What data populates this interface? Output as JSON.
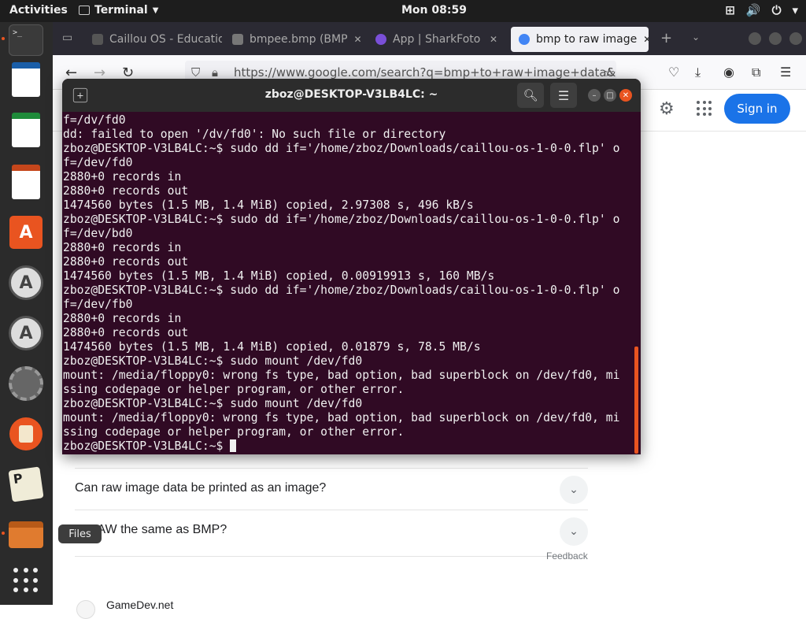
{
  "topbar": {
    "activities": "Activities",
    "app_name": "Terminal",
    "clock": "Mon 08:59",
    "tray_icons": [
      "network-icon",
      "volume-icon",
      "power-icon",
      "menu-caret-icon"
    ]
  },
  "dock": {
    "items": [
      "terminal",
      "libreoffice-writer",
      "libreoffice-calc",
      "libreoffice-impress",
      "software-store",
      "software-updater",
      "software-updater-2",
      "settings",
      "app-round",
      "pos-app",
      "files",
      "show-applications"
    ],
    "tooltip": "Files"
  },
  "browser": {
    "tabs": [
      {
        "label": "Caillou OS - Educatio",
        "favicon_color": "#555555"
      },
      {
        "label": "bmpee.bmp (BMP",
        "favicon_color": "#777777"
      },
      {
        "label": "App | SharkFoto",
        "favicon_color": "#7a4fd8"
      },
      {
        "label": "bmp to raw image",
        "favicon_color": "#4285f4"
      }
    ],
    "url": "https://www.google.com/search?q=bmp+to+raw+image+data&cl",
    "google": {
      "signin": "Sign in",
      "faq": [
        "Can raw image data be printed as an image?",
        "Is RAW the same as BMP?"
      ],
      "feedback": "Feedback",
      "result_source": "GameDev.net"
    }
  },
  "terminal": {
    "title": "zboz@DESKTOP-V3LB4LC: ~",
    "lines": [
      "f=/dv/fd0",
      "dd: failed to open '/dv/fd0': No such file or directory",
      "zboz@DESKTOP-V3LB4LC:~$ sudo dd if='/home/zboz/Downloads/caillou-os-1-0-0.flp' o",
      "f=/dev/fd0",
      "2880+0 records in",
      "2880+0 records out",
      "1474560 bytes (1.5 MB, 1.4 MiB) copied, 2.97308 s, 496 kB/s",
      "zboz@DESKTOP-V3LB4LC:~$ sudo dd if='/home/zboz/Downloads/caillou-os-1-0-0.flp' o",
      "f=/dev/bd0",
      "2880+0 records in",
      "2880+0 records out",
      "1474560 bytes (1.5 MB, 1.4 MiB) copied, 0.00919913 s, 160 MB/s",
      "zboz@DESKTOP-V3LB4LC:~$ sudo dd if='/home/zboz/Downloads/caillou-os-1-0-0.flp' o",
      "f=/dev/fb0",
      "2880+0 records in",
      "2880+0 records out",
      "1474560 bytes (1.5 MB, 1.4 MiB) copied, 0.01879 s, 78.5 MB/s",
      "zboz@DESKTOP-V3LB4LC:~$ sudo mount /dev/fd0",
      "mount: /media/floppy0: wrong fs type, bad option, bad superblock on /dev/fd0, mi",
      "ssing codepage or helper program, or other error.",
      "zboz@DESKTOP-V3LB4LC:~$ sudo mount /dev/fd0",
      "mount: /media/floppy0: wrong fs type, bad option, bad superblock on /dev/fd0, mi",
      "ssing codepage or helper program, or other error."
    ],
    "prompt": "zboz@DESKTOP-V3LB4LC:~$ "
  }
}
